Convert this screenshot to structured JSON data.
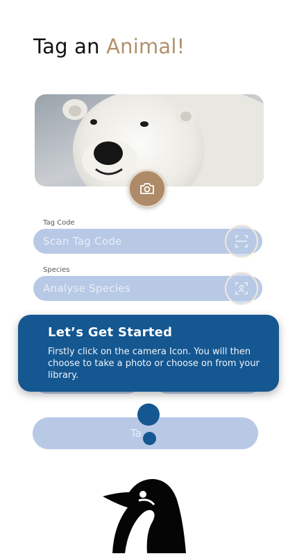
{
  "header": {
    "title_prefix": "Tag an ",
    "title_accent": "Animal!"
  },
  "photo": {
    "icon": "camera-icon"
  },
  "tag_code": {
    "label": "Tag Code",
    "placeholder": "Scan Tag Code",
    "icon": "barcode-scan-icon"
  },
  "species": {
    "label": "Species",
    "placeholder": "Analyse Species",
    "icon": "face-scan-icon"
  },
  "tooltip": {
    "title": "Let’s Get Started",
    "body": "Firstly click on the camera Icon. You will then choose to take a photo or choose on from your library."
  },
  "submit": {
    "label_visible": "Ta"
  },
  "colors": {
    "accent": "#b0906c",
    "field": "#b8c9e6",
    "tooltip": "#145791"
  }
}
